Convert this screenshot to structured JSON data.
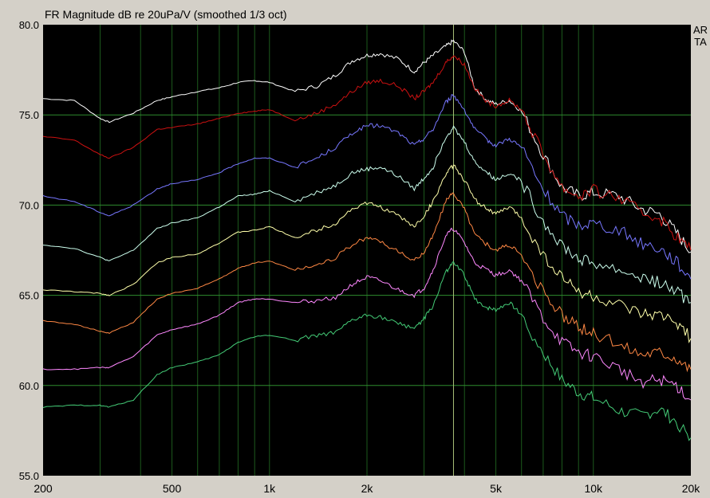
{
  "chart_data": {
    "type": "line",
    "title": "FR Magnitude dB re 20uPa/V (smoothed 1/3 oct)",
    "brand": "ARTA",
    "x_scale": "log",
    "xlim": [
      200,
      20000
    ],
    "ylim": [
      55,
      80
    ],
    "grid": true,
    "x_tick_labels": [
      {
        "value": 200,
        "label": "200"
      },
      {
        "value": 500,
        "label": "500"
      },
      {
        "value": 1000,
        "label": "1k"
      },
      {
        "value": 2000,
        "label": "2k"
      },
      {
        "value": 5000,
        "label": "5k"
      },
      {
        "value": 10000,
        "label": "10k"
      },
      {
        "value": 20000,
        "label": "20k"
      }
    ],
    "y_tick_labels": [
      {
        "value": 80,
        "label": "80.0"
      },
      {
        "value": 75,
        "label": "75.0"
      },
      {
        "value": 70,
        "label": "70.0"
      },
      {
        "value": 65,
        "label": "65.0"
      },
      {
        "value": 60,
        "label": "60.0"
      },
      {
        "value": 55,
        "label": "55.0"
      }
    ],
    "cursor_x": 3700,
    "x": [
      200,
      250,
      300,
      320,
      380,
      450,
      500,
      600,
      700,
      800,
      900,
      1000,
      1200,
      1400,
      1600,
      1800,
      2000,
      2200,
      2500,
      2800,
      3000,
      3200,
      3500,
      3700,
      4000,
      4300,
      4700,
      5000,
      5500,
      6000,
      7000,
      8000,
      9000,
      10000,
      12000,
      14000,
      16000,
      18000,
      20000
    ],
    "series": [
      {
        "color": "#ffffff",
        "values": [
          75.9,
          75.8,
          74.8,
          74.6,
          75.1,
          75.8,
          76.0,
          76.3,
          76.5,
          76.8,
          76.9,
          76.8,
          76.3,
          76.6,
          77.2,
          78.0,
          78.3,
          78.4,
          78.1,
          77.4,
          77.9,
          78.3,
          78.8,
          79.1,
          78.5,
          76.5,
          75.8,
          75.6,
          75.8,
          75.2,
          72.8,
          71.0,
          70.5,
          70.7,
          70.5,
          69.8,
          69.5,
          68.5,
          67.4
        ]
      },
      {
        "color": "#cc1111",
        "values": [
          73.8,
          73.6,
          72.8,
          72.6,
          73.2,
          74.2,
          74.3,
          74.5,
          74.8,
          75.1,
          75.2,
          75.3,
          74.7,
          75.1,
          75.6,
          76.3,
          76.8,
          76.9,
          76.6,
          75.9,
          76.3,
          76.8,
          77.9,
          78.3,
          77.8,
          76.5,
          75.7,
          75.5,
          75.8,
          75.3,
          72.8,
          71.0,
          70.5,
          70.8,
          70.4,
          69.6,
          69.3,
          68.3,
          67.5
        ]
      },
      {
        "color": "#7777ff",
        "values": [
          70.5,
          70.2,
          69.6,
          69.4,
          70.0,
          70.9,
          71.2,
          71.4,
          71.8,
          72.3,
          72.6,
          72.6,
          72.1,
          72.6,
          73.2,
          74.0,
          74.4,
          74.4,
          74.0,
          73.3,
          73.7,
          74.2,
          75.7,
          76.1,
          75.3,
          74.2,
          73.6,
          73.3,
          73.7,
          73.2,
          70.8,
          69.4,
          68.9,
          69.0,
          68.6,
          67.9,
          67.6,
          66.9,
          65.9
        ]
      },
      {
        "color": "#ccffee",
        "values": [
          67.8,
          67.6,
          67.1,
          66.9,
          67.5,
          68.7,
          69.0,
          69.3,
          69.9,
          70.5,
          70.6,
          70.8,
          70.2,
          70.7,
          71.1,
          71.8,
          72.0,
          72.1,
          71.6,
          70.9,
          71.5,
          72.1,
          73.8,
          74.3,
          73.5,
          72.4,
          71.8,
          71.4,
          71.8,
          71.3,
          69.1,
          67.8,
          67.0,
          66.8,
          66.4,
          66.0,
          65.7,
          65.2,
          64.6
        ]
      },
      {
        "color": "#ffffaa",
        "values": [
          65.3,
          65.2,
          65.1,
          65.0,
          65.6,
          66.8,
          67.1,
          67.3,
          67.9,
          68.5,
          68.6,
          68.8,
          68.2,
          68.6,
          69.0,
          69.8,
          70.1,
          69.9,
          69.4,
          68.8,
          69.4,
          70.2,
          71.7,
          72.2,
          71.4,
          70.3,
          69.8,
          69.5,
          69.9,
          69.3,
          67.2,
          66.0,
          65.2,
          64.9,
          64.4,
          63.9,
          63.8,
          63.6,
          62.6
        ]
      },
      {
        "color": "#ff8844",
        "values": [
          63.6,
          63.4,
          63.0,
          62.9,
          63.5,
          64.8,
          65.1,
          65.4,
          65.9,
          66.5,
          66.8,
          66.9,
          66.4,
          66.7,
          67.1,
          67.8,
          68.2,
          68.0,
          67.4,
          66.9,
          67.4,
          68.3,
          70.2,
          70.7,
          69.8,
          68.4,
          67.8,
          67.5,
          67.8,
          67.2,
          65.1,
          63.9,
          63.2,
          62.9,
          62.3,
          61.8,
          61.9,
          61.6,
          60.9
        ]
      },
      {
        "color": "#ff88ff",
        "values": [
          60.9,
          60.9,
          61.0,
          61.0,
          61.6,
          62.8,
          63.1,
          63.4,
          63.9,
          64.6,
          64.8,
          64.8,
          64.6,
          64.7,
          64.9,
          65.6,
          66.0,
          65.8,
          65.3,
          65.0,
          65.4,
          66.4,
          68.3,
          68.7,
          67.9,
          66.8,
          66.4,
          66.1,
          66.4,
          65.8,
          63.7,
          62.4,
          61.8,
          61.6,
          60.9,
          60.2,
          60.3,
          60.0,
          59.2
        ]
      },
      {
        "color": "#44cc77",
        "values": [
          58.8,
          58.9,
          58.9,
          58.8,
          59.2,
          60.6,
          61.0,
          61.3,
          61.7,
          62.4,
          62.7,
          62.8,
          62.5,
          62.8,
          62.9,
          63.6,
          63.9,
          63.8,
          63.4,
          63.2,
          63.7,
          64.4,
          66.3,
          66.8,
          66.1,
          64.8,
          64.3,
          64.2,
          64.6,
          63.9,
          61.8,
          60.3,
          59.6,
          59.3,
          58.6,
          58.3,
          58.7,
          58.0,
          57.1
        ]
      }
    ]
  }
}
